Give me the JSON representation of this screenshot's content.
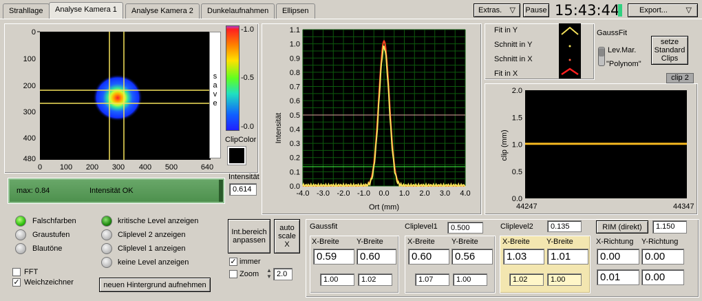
{
  "tabs": [
    "Strahllage",
    "Analyse Kamera 1",
    "Analyse Kamera 2",
    "Dunkelaufnahmen",
    "Ellipsen"
  ],
  "active_tab": "Analyse Kamera 1",
  "topbar": {
    "extras": "Extras.",
    "pause": "Pause",
    "clock": "15:43:44",
    "export": "Export..."
  },
  "image": {
    "xticks": [
      "0",
      "100",
      "200",
      "300",
      "400",
      "500",
      "640"
    ],
    "yticks": [
      "0",
      "100",
      "200",
      "300",
      "400",
      "480"
    ],
    "save_label": "s a v e",
    "colorbar_ticks": [
      "-1.0",
      "-0.5",
      "-0.0"
    ],
    "clipcolor_label": "ClipColor",
    "intensity_label": "Intensität",
    "intensity_value": "0.614"
  },
  "status": {
    "max": "max: 0.84",
    "message": "Intensität OK"
  },
  "profile_chart": {
    "yticks": [
      "1.1",
      "1.0",
      "0.9",
      "0.8",
      "0.7",
      "0.6",
      "0.5",
      "0.4",
      "0.3",
      "0.2",
      "0.1",
      "0.0"
    ],
    "xticks": [
      "-4.0",
      "-3.0",
      "-2.0",
      "-1.0",
      "0.0",
      "1.0",
      "2.0",
      "3.0",
      "4.0"
    ],
    "ylabel": "Intensität",
    "xlabel": "Ort (mm)"
  },
  "legend": {
    "items": [
      "Fit in Y",
      "Schnitt in Y",
      "Schnitt in X",
      "Fit in X"
    ]
  },
  "gaussfit": {
    "title": "GaussFit",
    "option1": "Lev.Mar.",
    "option2": "\"Polynom\"",
    "button": "setze Standard Clips",
    "clip_selector": "clip 2"
  },
  "clip_chart": {
    "yticks": [
      "2.0",
      "1.5",
      "1.0",
      "0.5",
      "0.0"
    ],
    "ylabel": "clip (mm)",
    "xmin": "44247",
    "xmax": "44347"
  },
  "display_options": {
    "col1": [
      "Falschfarben",
      "Graustufen",
      "Blautöne"
    ],
    "col2": [
      "kritische Level anzeigen",
      "Cliplevel 2 anzeigen",
      "Cliplevel 1 anzeigen",
      "keine Level anzeigen"
    ],
    "fft": "FFT",
    "weich": "Weichzeichner",
    "new_bg": "neuen Hintergrund aufnehmen"
  },
  "controls": {
    "int_range": "Int.bereich anpassen",
    "autoscale": "auto scale X",
    "immer": "immer",
    "zoom": "Zoom",
    "zoom_value": "2.0"
  },
  "results": {
    "gaussfit_label": "Gaussfit",
    "cliplevel1_label": "Cliplevel1",
    "cliplevel1_value": "0.500",
    "cliplevel2_label": "Cliplevel2",
    "cliplevel2_value": "0.135",
    "rim_button": "RIM (direkt)",
    "rim_value": "1.150",
    "xb": "X-Breite",
    "yb": "Y-Breite",
    "xr": "X-Richtung",
    "yr": "Y-Richtung",
    "g": {
      "x": "0.59",
      "y": "0.60",
      "sx": "1.00",
      "sy": "1.02"
    },
    "c1": {
      "x": "0.60",
      "y": "0.56",
      "sx": "1.07",
      "sy": "1.00"
    },
    "c2": {
      "x": "1.03",
      "y": "1.01",
      "sx": "1.02",
      "sy": "1.00"
    },
    "r": {
      "x": "0.00",
      "y": "0.00",
      "x2": "0.01",
      "y2": "0.00"
    }
  },
  "colors": {
    "accent_yellow": "#f5e25a",
    "ok_green": "#5aa85a",
    "profile_bg": "#000000"
  }
}
